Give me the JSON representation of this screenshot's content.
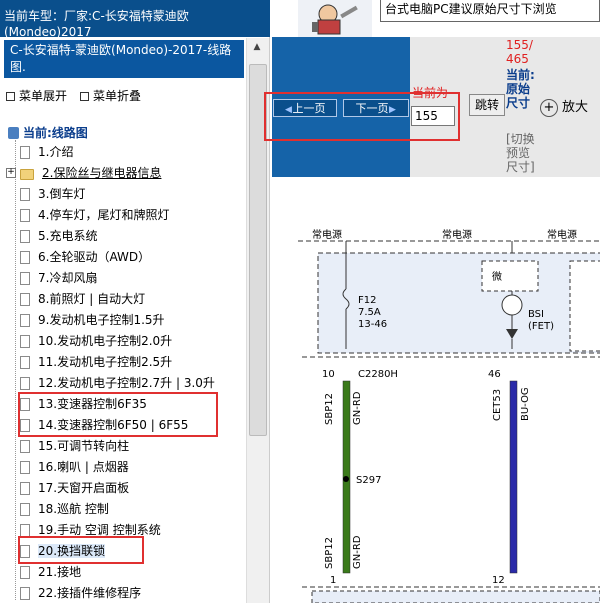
{
  "header": {
    "current_model_label": "当前车型：",
    "current_model_value": "厂家:C-长安福特蒙迪欧",
    "current_model_line2": "(Mondeo)2017",
    "banner_text": "台式电脑PC建议原始尺寸下浏览"
  },
  "sidebar": {
    "car_title": "C-长安福特-蒙迪欧(Mondeo)-2017-线路图.",
    "expand_all": "菜单展开",
    "collapse_all": "菜单折叠",
    "root_label": "当前:线路图",
    "items": [
      {
        "label": "1.介绍"
      },
      {
        "label": "2.保险丝与继电器信息"
      },
      {
        "label": "3.倒车灯"
      },
      {
        "label": "4.停车灯，尾灯和牌照灯"
      },
      {
        "label": "5.充电系统"
      },
      {
        "label": "6.全轮驱动（AWD）"
      },
      {
        "label": "7.冷却风扇"
      },
      {
        "label": "8.前照灯 | 自动大灯"
      },
      {
        "label": "9.发动机电子控制1.5升"
      },
      {
        "label": "10.发动机电子控制2.0升"
      },
      {
        "label": "11.发动机电子控制2.5升"
      },
      {
        "label": "12.发动机电子控制2.7升 | 3.0升"
      },
      {
        "label": "13.变速器控制6F35"
      },
      {
        "label": "14.变速器控制6F50 | 6F55"
      },
      {
        "label": "15.可调节转向柱"
      },
      {
        "label": "16.喇叭 | 点烟器"
      },
      {
        "label": "17.天窗开启面板"
      },
      {
        "label": "18.巡航 控制"
      },
      {
        "label": "19.手动 空调 控制系统"
      },
      {
        "label": "20.换挡联锁"
      },
      {
        "label": "21.接地"
      },
      {
        "label": "22.接插件维修程序"
      }
    ]
  },
  "toolbar": {
    "prev_label": "上一页",
    "next_label": "下一页",
    "current_label": "当前为",
    "page_value": "155",
    "jump_label": "跳转",
    "page_count_top": "155/",
    "page_count_bottom": "465",
    "current_size_label": "当前:",
    "original_size": "原始尺寸",
    "switch_preview": "[切换预览尺寸]",
    "zoom_in_label": "放大"
  },
  "diagram": {
    "labels": {
      "constant_power_1": "常电源",
      "constant_power_2": "常电源",
      "constant_power_3": "常电源",
      "fuse": "F12",
      "fuse_amp": "7.5A",
      "fuse_pos": "13-46",
      "micro": "微",
      "bsi": "BSI",
      "fet": "(FET)",
      "pin_10": "10",
      "conn_c2280h": "C2280H",
      "pin_46": "46",
      "wire_sbp12": "SBP12",
      "wire_gnrd": "GN-RD",
      "wire_cet53": "CET53",
      "wire_buog": "BU-OG",
      "splice": "S297",
      "wire_sbp12_b": "SBP12",
      "wire_gnrd_b": "GN-RD",
      "pin_1": "1",
      "pin_12": "12"
    },
    "colors": {
      "wire_green": "#3a7a1a",
      "wire_blue": "#2a2aa8",
      "box_fill": "#e8eef8"
    }
  }
}
